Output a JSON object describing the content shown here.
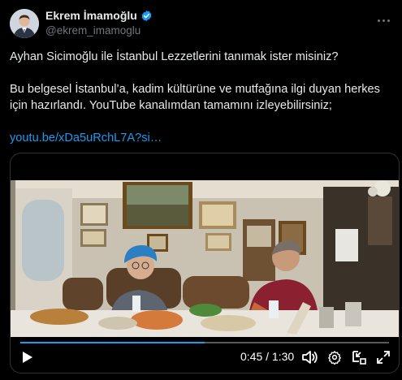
{
  "author": {
    "display_name": "Ekrem İmamoğlu",
    "handle": "@ekrem_imamoglu",
    "verified": true,
    "verified_color": "#1d9bf0"
  },
  "tweet": {
    "line1": "Ayhan Sicimoğlu ile İstanbul Lezzetlerini tanımak ister misiniz?",
    "line2": "Bu belgesel İstanbul’a, kadim kültürüne ve mutfağına ilgi duyan herkes için hazırlandı. YouTube kanalımdan tamamını izleyebilirsiniz;",
    "link": "youtu.be/xDa5uRchL7A?si…",
    "link_color": "#1d9bf0"
  },
  "video": {
    "time_display": "0:45 / 1:30",
    "progress": 0.5,
    "controls": [
      "play-icon",
      "volume-icon",
      "settings-icon",
      "pip-icon",
      "fullscreen-icon"
    ]
  }
}
